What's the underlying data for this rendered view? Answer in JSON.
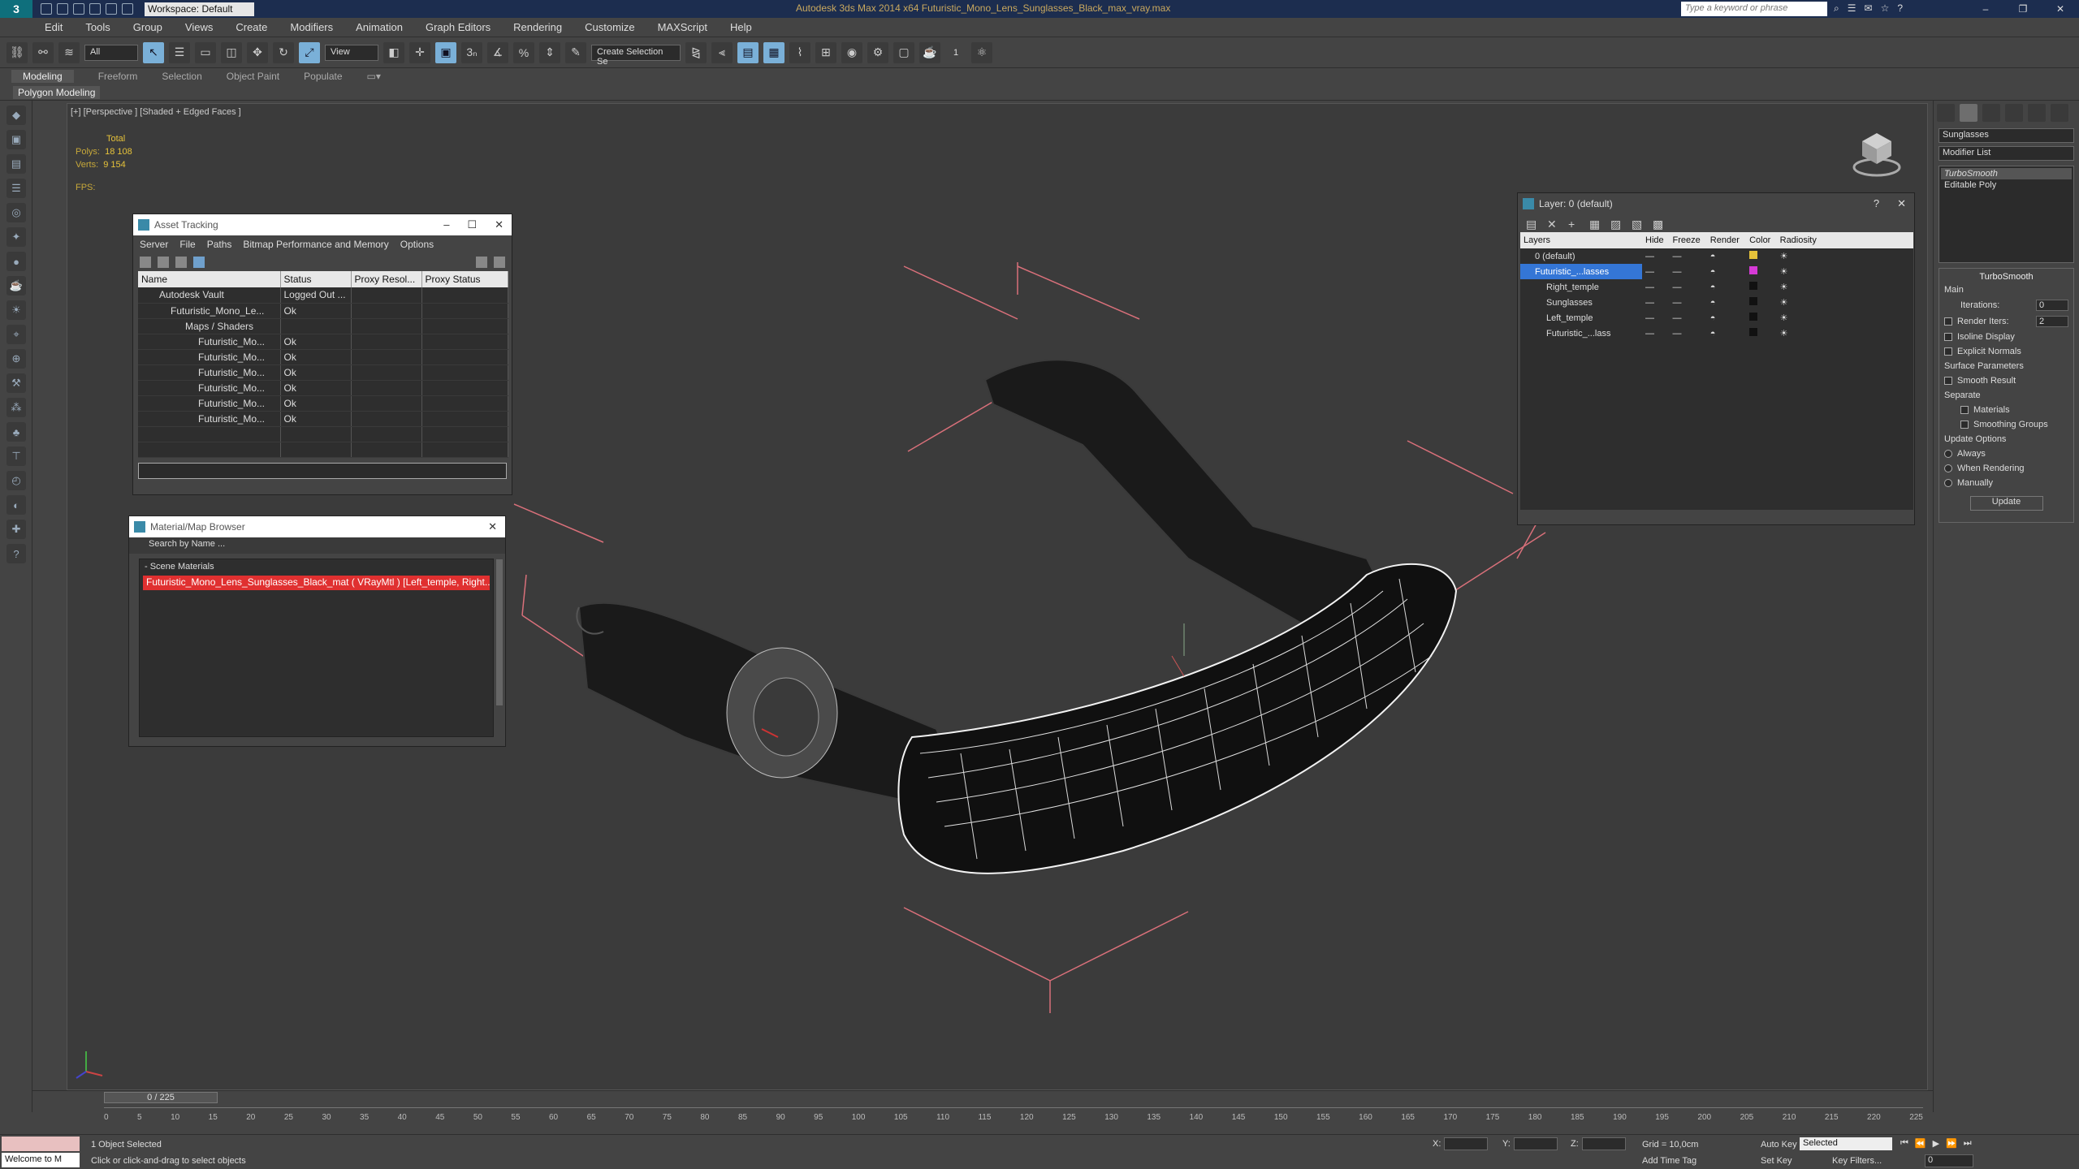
{
  "app": {
    "title": "Autodesk 3ds Max  2014 x64     Futuristic_Mono_Lens_Sunglasses_Black_max_vray.max",
    "workspace": "Workspace: Default",
    "search_placeholder": "Type a keyword or phrase",
    "logo": "3"
  },
  "menu": [
    "Edit",
    "Tools",
    "Group",
    "Views",
    "Create",
    "Modifiers",
    "Animation",
    "Graph Editors",
    "Rendering",
    "Customize",
    "MAXScript",
    "Help"
  ],
  "toolbar": {
    "filter": "All",
    "refcoord": "View",
    "selection_set": "Create Selection Se",
    "spinner_value": "1"
  },
  "ribbon": {
    "tabs": [
      "Modeling",
      "Freeform",
      "Selection",
      "Object Paint",
      "Populate"
    ],
    "active": "Modeling",
    "sub": "Polygon Modeling"
  },
  "viewport": {
    "label": "[+] [Perspective ] [Shaded + Edged Faces ]",
    "stats": {
      "total": "Total",
      "polys_label": "Polys:",
      "polys": "18 108",
      "verts_label": "Verts:",
      "verts": "9 154",
      "fps": "FPS:"
    }
  },
  "asset_tracking": {
    "title": "Asset Tracking",
    "menu": [
      "Server",
      "File",
      "Paths",
      "Bitmap Performance and Memory",
      "Options"
    ],
    "columns": [
      "Name",
      "Status",
      "Proxy Resol...",
      "Proxy Status"
    ],
    "rows": [
      {
        "name": "Autodesk Vault",
        "status": "Logged Out ...",
        "indent": 1
      },
      {
        "name": "Futuristic_Mono_Le...",
        "status": "Ok",
        "indent": 2
      },
      {
        "name": "Maps / Shaders",
        "status": "",
        "indent": 3
      },
      {
        "name": "Futuristic_Mo...",
        "status": "Ok",
        "indent": 4
      },
      {
        "name": "Futuristic_Mo...",
        "status": "Ok",
        "indent": 4
      },
      {
        "name": "Futuristic_Mo...",
        "status": "Ok",
        "indent": 4
      },
      {
        "name": "Futuristic_Mo...",
        "status": "Ok",
        "indent": 4
      },
      {
        "name": "Futuristic_Mo...",
        "status": "Ok",
        "indent": 4
      },
      {
        "name": "Futuristic_Mo...",
        "status": "Ok",
        "indent": 4
      }
    ]
  },
  "material_browser": {
    "title": "Material/Map Browser",
    "search": "Search by Name ...",
    "group": "- Scene Materials",
    "item": "Futuristic_Mono_Lens_Sunglasses_Black_mat ( VRayMtl ) [Left_temple, Right..."
  },
  "layer_manager": {
    "title": "Layer: 0 (default)",
    "columns": [
      "Layers",
      "Hide",
      "Freeze",
      "Render",
      "Color",
      "Radiosity"
    ],
    "rows": [
      {
        "name": "0 (default)",
        "color": "#e6c23a",
        "selected": false,
        "indent": 0
      },
      {
        "name": "Futuristic_...lasses",
        "color": "#d63ad6",
        "selected": true,
        "indent": 0
      },
      {
        "name": "Right_temple",
        "color": "#111111",
        "selected": false,
        "indent": 1
      },
      {
        "name": "Sunglasses",
        "color": "#111111",
        "selected": false,
        "indent": 1
      },
      {
        "name": "Left_temple",
        "color": "#111111",
        "selected": false,
        "indent": 1
      },
      {
        "name": "Futuristic_...lass",
        "color": "#111111",
        "selected": false,
        "indent": 1
      }
    ]
  },
  "command_panel": {
    "object_name": "Sunglasses",
    "modifier_list": "Modifier List",
    "stack": [
      "TurboSmooth",
      "Editable Poly"
    ],
    "rollout": "TurboSmooth",
    "main": "Main",
    "iterations_label": "Iterations:",
    "iterations": "0",
    "render_iters_label": "Render Iters:",
    "render_iters": "2",
    "isoline": "Isoline Display",
    "explicit": "Explicit Normals",
    "surface": "Surface Parameters",
    "smooth_result": "Smooth Result",
    "separate": "Separate",
    "materials": "Materials",
    "smoothing_groups": "Smoothing Groups",
    "update_options": "Update Options",
    "always": "Always",
    "when_rendering": "When Rendering",
    "manually": "Manually",
    "update": "Update"
  },
  "timeline": {
    "frame": "0 / 225",
    "ticks": [
      "0",
      "5",
      "10",
      "15",
      "20",
      "25",
      "30",
      "35",
      "40",
      "45",
      "50",
      "55",
      "60",
      "65",
      "70",
      "75",
      "80",
      "85",
      "90",
      "95",
      "100",
      "105",
      "110",
      "115",
      "120",
      "125",
      "130",
      "135",
      "140",
      "145",
      "150",
      "155",
      "160",
      "165",
      "170",
      "175",
      "180",
      "185",
      "190",
      "195",
      "200",
      "205",
      "210",
      "215",
      "220",
      "225"
    ]
  },
  "status": {
    "listener": "Welcome to M",
    "selected": "1 Object Selected",
    "prompt": "Click or click-and-drag to select objects",
    "x": "X:",
    "y": "Y:",
    "z": "Z:",
    "grid": "Grid = 10,0cm",
    "add_time": "Add Time Tag",
    "auto_key": "Auto Key",
    "set_key": "Set Key",
    "selected_drop": "Selected",
    "key_filters": "Key Filters...",
    "frame": "0"
  }
}
